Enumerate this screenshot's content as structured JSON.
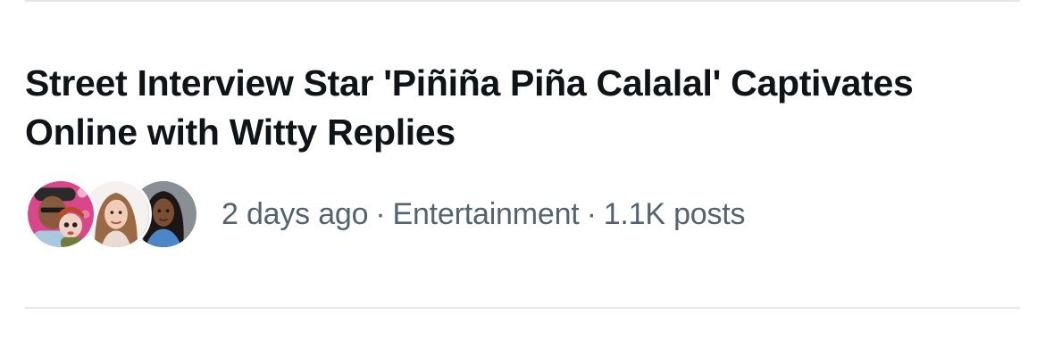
{
  "trend": {
    "title": "Street Interview Star 'Piñiña Piña Calalal' Captivates Online with Witty Replies",
    "time": "2 days ago",
    "separator": "·",
    "category": "Entertainment",
    "posts": "1.1K posts"
  },
  "avatars": [
    {
      "icon": "person-with-doll-avatar"
    },
    {
      "icon": "woman-portrait-avatar"
    },
    {
      "icon": "woman-portrait-avatar"
    }
  ],
  "colors": {
    "title": "#0f1419",
    "meta": "#536471",
    "divider": "#e4e7ea"
  }
}
